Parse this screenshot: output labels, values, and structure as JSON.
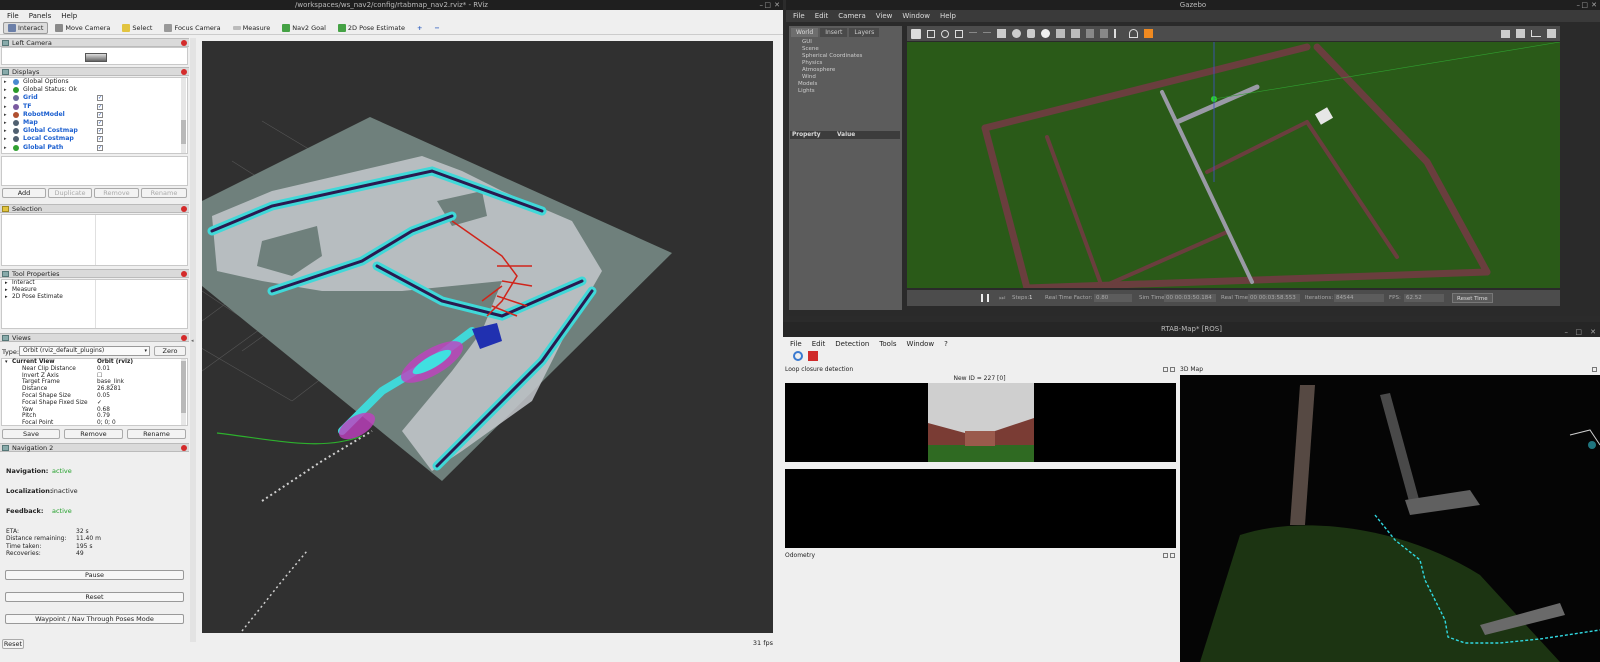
{
  "rviz": {
    "title": "/workspaces/ws_nav2/config/rtabmap_nav2.rviz* - RViz",
    "menu": [
      "File",
      "Panels",
      "Help"
    ],
    "tools": [
      {
        "label": "Interact",
        "icon": "interact-icon",
        "active": true
      },
      {
        "label": "Move Camera",
        "icon": "move-camera-icon"
      },
      {
        "label": "Select",
        "icon": "select-icon"
      },
      {
        "label": "Focus Camera",
        "icon": "focus-camera-icon"
      },
      {
        "label": "Measure",
        "icon": "measure-icon"
      },
      {
        "label": "Nav2 Goal",
        "icon": "nav2-goal-icon"
      },
      {
        "label": "2D Pose Estimate",
        "icon": "pose-estimate-icon"
      }
    ],
    "left_camera": {
      "title": "Left Camera"
    },
    "displays": {
      "title": "Displays",
      "items": [
        {
          "label": "Global Options",
          "bold": false,
          "checked": null,
          "color": "#4a8ad0"
        },
        {
          "label": "Global Status: Ok",
          "bold": false,
          "checked": null,
          "color": "#2a9a2a"
        },
        {
          "label": "Grid",
          "bold": true,
          "checked": true,
          "color": "#6a6a9a"
        },
        {
          "label": "TF",
          "bold": true,
          "checked": true,
          "color": "#7a5aa0"
        },
        {
          "label": "RobotModel",
          "bold": true,
          "checked": true,
          "color": "#b05030"
        },
        {
          "label": "Map",
          "bold": true,
          "checked": true,
          "color": "#506070"
        },
        {
          "label": "Global Costmap",
          "bold": true,
          "checked": true,
          "color": "#506070"
        },
        {
          "label": "Local Costmap",
          "bold": true,
          "checked": true,
          "color": "#506070"
        },
        {
          "label": "Global Path",
          "bold": true,
          "checked": true,
          "color": "#30a030"
        }
      ],
      "buttons": [
        "Add",
        "Duplicate",
        "Remove",
        "Rename"
      ]
    },
    "selection": {
      "title": "Selection"
    },
    "tool_properties": {
      "title": "Tool Properties",
      "items": [
        "Interact",
        "Measure",
        "2D Pose Estimate"
      ]
    },
    "views": {
      "title": "Views",
      "type_label": "Type:",
      "type_value": "Orbit (rviz_default_plugins)",
      "zero": "Zero",
      "current_view": "Current View",
      "current_view_value": "Orbit (rviz)",
      "props": [
        {
          "k": "Near Clip Distance",
          "v": "0.01"
        },
        {
          "k": "Invert Z Axis",
          "v": "☐"
        },
        {
          "k": "Target Frame",
          "v": "base_link"
        },
        {
          "k": "Distance",
          "v": "26.8281"
        },
        {
          "k": "Focal Shape Size",
          "v": "0.05"
        },
        {
          "k": "Focal Shape Fixed Size",
          "v": "✓"
        },
        {
          "k": "Yaw",
          "v": "0.68"
        },
        {
          "k": "Pitch",
          "v": "0.79"
        },
        {
          "k": "Focal Point",
          "v": "0; 0; 0"
        }
      ],
      "buttons": [
        "Save",
        "Remove",
        "Rename"
      ]
    },
    "nav2": {
      "title": "Navigation 2",
      "navigation_label": "Navigation:",
      "navigation_value": "active",
      "localization_label": "Localization:",
      "localization_value": "inactive",
      "feedback_label": "Feedback:",
      "feedback_value": "active",
      "stats": [
        {
          "k": "ETA:",
          "v": "32 s"
        },
        {
          "k": "Distance remaining:",
          "v": "11.40 m"
        },
        {
          "k": "Time taken:",
          "v": "195 s"
        },
        {
          "k": "Recoveries:",
          "v": "49"
        }
      ],
      "pause": "Pause",
      "reset": "Reset",
      "waypoint": "Waypoint / Nav Through Poses Mode"
    },
    "reset": "Reset",
    "fps": "31 fps"
  },
  "gazebo": {
    "title": "Gazebo",
    "menu": [
      "File",
      "Edit",
      "Camera",
      "View",
      "Window",
      "Help"
    ],
    "tabs": [
      "World",
      "Insert",
      "Layers"
    ],
    "tree": [
      "GUI",
      "Scene",
      "Spherical Coordinates",
      "Physics",
      "Atmosphere",
      "Wind",
      "Models",
      "Lights"
    ],
    "prop_header": "Property",
    "value_header": "Value",
    "status": {
      "steps_label": "Steps:",
      "steps_value": "1",
      "rtf_label": "Real Time Factor:",
      "rtf_value": "0.80",
      "sim_label": "Sim Time:",
      "sim_value": "00 00:03:50.184",
      "real_label": "Real Time:",
      "real_value": "00 00:03:58.553",
      "iter_label": "Iterations:",
      "iter_value": "84544",
      "fps_label": "FPS:",
      "fps_value": "62.52",
      "reset_time": "Reset Time"
    }
  },
  "rtab": {
    "title": "RTAB-Map* [ROS]",
    "menu": [
      "File",
      "Edit",
      "Detection",
      "Tools",
      "Window",
      "?"
    ],
    "loop_title": "Loop closure detection",
    "new_id": "New ID = 227 [0]",
    "odometry_title": "Odometry",
    "map_title": "3D Map"
  }
}
